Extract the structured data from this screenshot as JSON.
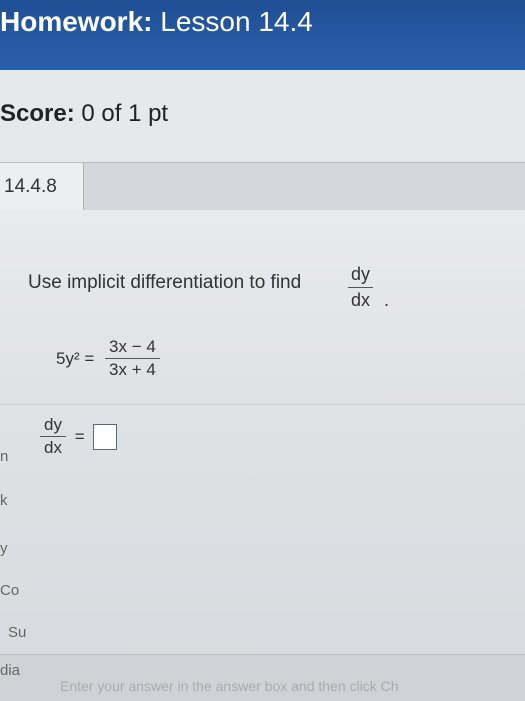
{
  "header": {
    "title_bold": "Homework:",
    "title_rest": " Lesson 14.4"
  },
  "score": {
    "label": "Score:",
    "value": " 0 of 1 pt"
  },
  "question": {
    "id": "14.4.8"
  },
  "prompt": {
    "text": "Use implicit differentiation to find",
    "frac_num": "dy",
    "frac_den": "dx",
    "end": "."
  },
  "equation": {
    "lhs": "5y² =",
    "rhs_num": "3x − 4",
    "rhs_den": "3x + 4"
  },
  "answer": {
    "num": "dy",
    "den": "dx",
    "eq": "="
  },
  "side_labels": [
    "n",
    "k",
    "y",
    "Co",
    "Su",
    "dia"
  ],
  "footer": {
    "text": "Enter your answer in the answer box and then click Ch"
  },
  "colors": {
    "header_blue": "#2a61ab",
    "panel": "#e6e8ea"
  }
}
